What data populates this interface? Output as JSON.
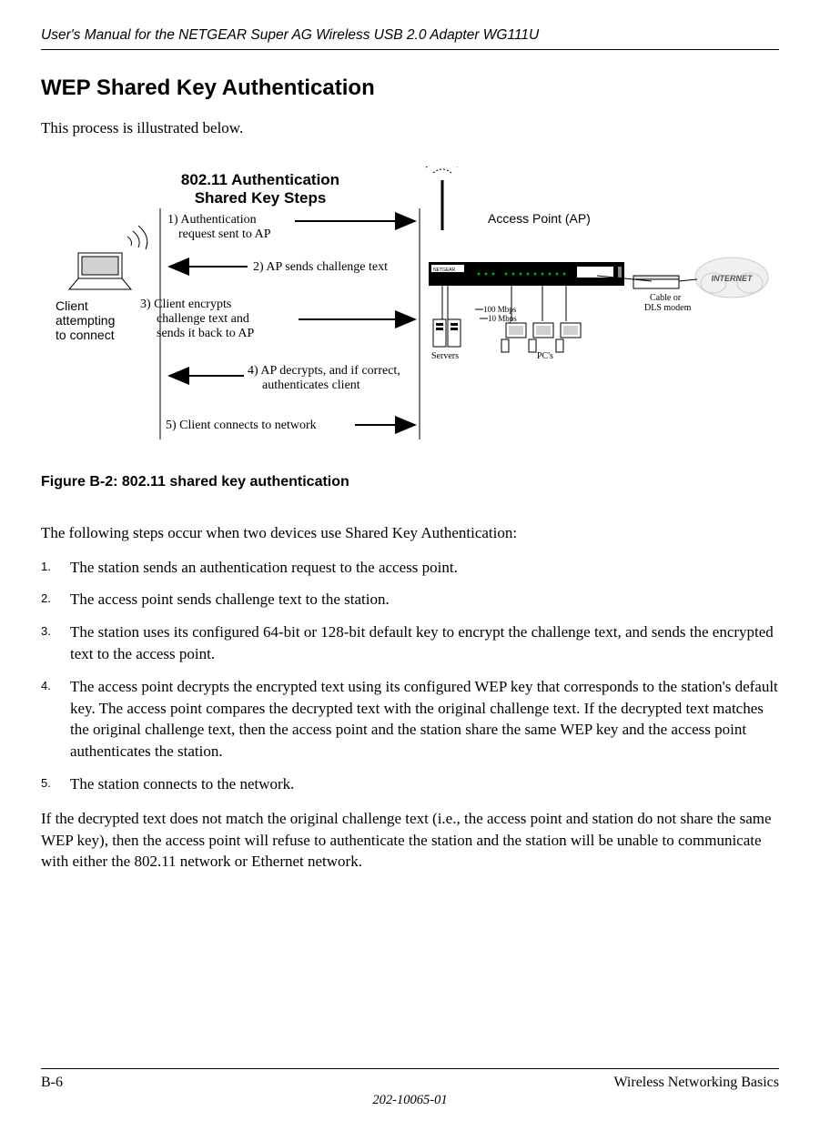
{
  "header": {
    "manual_title": "User's Manual for the NETGEAR Super AG Wireless USB 2.0 Adapter WG111U"
  },
  "section": {
    "heading": "WEP Shared Key Authentication",
    "intro": "This process is illustrated below.",
    "figure": {
      "title_line1": "802.11 Authentication",
      "title_line2": "Shared Key Steps",
      "client_line1": "Client",
      "client_line2": "attempting",
      "client_line3": "to connect",
      "ap_label": "Access Point (AP)",
      "step1_line1": "1) Authentication",
      "step1_line2": "request sent to AP",
      "step2": "2) AP sends challenge text",
      "step3_line1": "3) Client encrypts",
      "step3_line2": "challenge text and",
      "step3_line3": "sends it back to AP",
      "step4_line1": "4) AP decrypts, and if correct,",
      "step4_line2": "authenticates client",
      "step5": "5) Client connects to network",
      "cable_line1": "Cable or",
      "cable_line2": "DLS modem",
      "internet": "INTERNET",
      "servers": "Servers",
      "pcs": "PC's",
      "speed100": "100 Mbps",
      "speed10": "10 Mbps"
    },
    "caption": "Figure B-2:  802.11 shared key authentication",
    "lead": "The following steps occur when two devices use Shared Key Authentication:",
    "steps": [
      "The station sends an authentication request to the access point.",
      "The access point sends challenge text to the station.",
      "The station uses its configured 64-bit or 128-bit default key to encrypt the challenge text, and sends the encrypted text to the access point.",
      "The access point decrypts the encrypted text using its configured WEP key that corresponds to the station's default key. The access point compares the decrypted text with the original challenge text. If the decrypted text matches the original challenge text, then the access point and the station share the same WEP key and the access point authenticates the station.",
      "The station connects to the network."
    ],
    "after": "If the decrypted text does not match the original challenge text (i.e., the access point and station do not share the same WEP key), then the access point will refuse to authenticate the station and the station will be unable to communicate with either the 802.11 network or Ethernet network."
  },
  "footer": {
    "page": "B-6",
    "section_title": "Wireless Networking Basics",
    "docnum": "202-10065-01"
  }
}
